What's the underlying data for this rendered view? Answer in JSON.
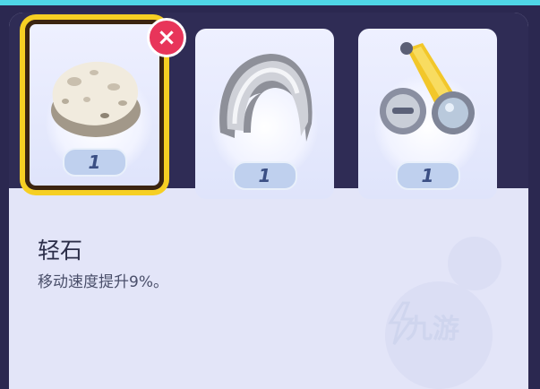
{
  "items": [
    {
      "name": "light-clay-icon",
      "count": "1",
      "selected": true
    },
    {
      "name": "muscle-band-icon",
      "count": "1",
      "selected": false
    },
    {
      "name": "scope-lens-icon",
      "count": "1",
      "selected": false
    }
  ],
  "selected_item": {
    "title": "轻石",
    "description": "移动速度提升9%。"
  },
  "remove_label": "×",
  "watermark": "九游",
  "colors": {
    "accent": "#f6cf23",
    "remove": "#e8355a",
    "panel": "#e3e5f8"
  }
}
